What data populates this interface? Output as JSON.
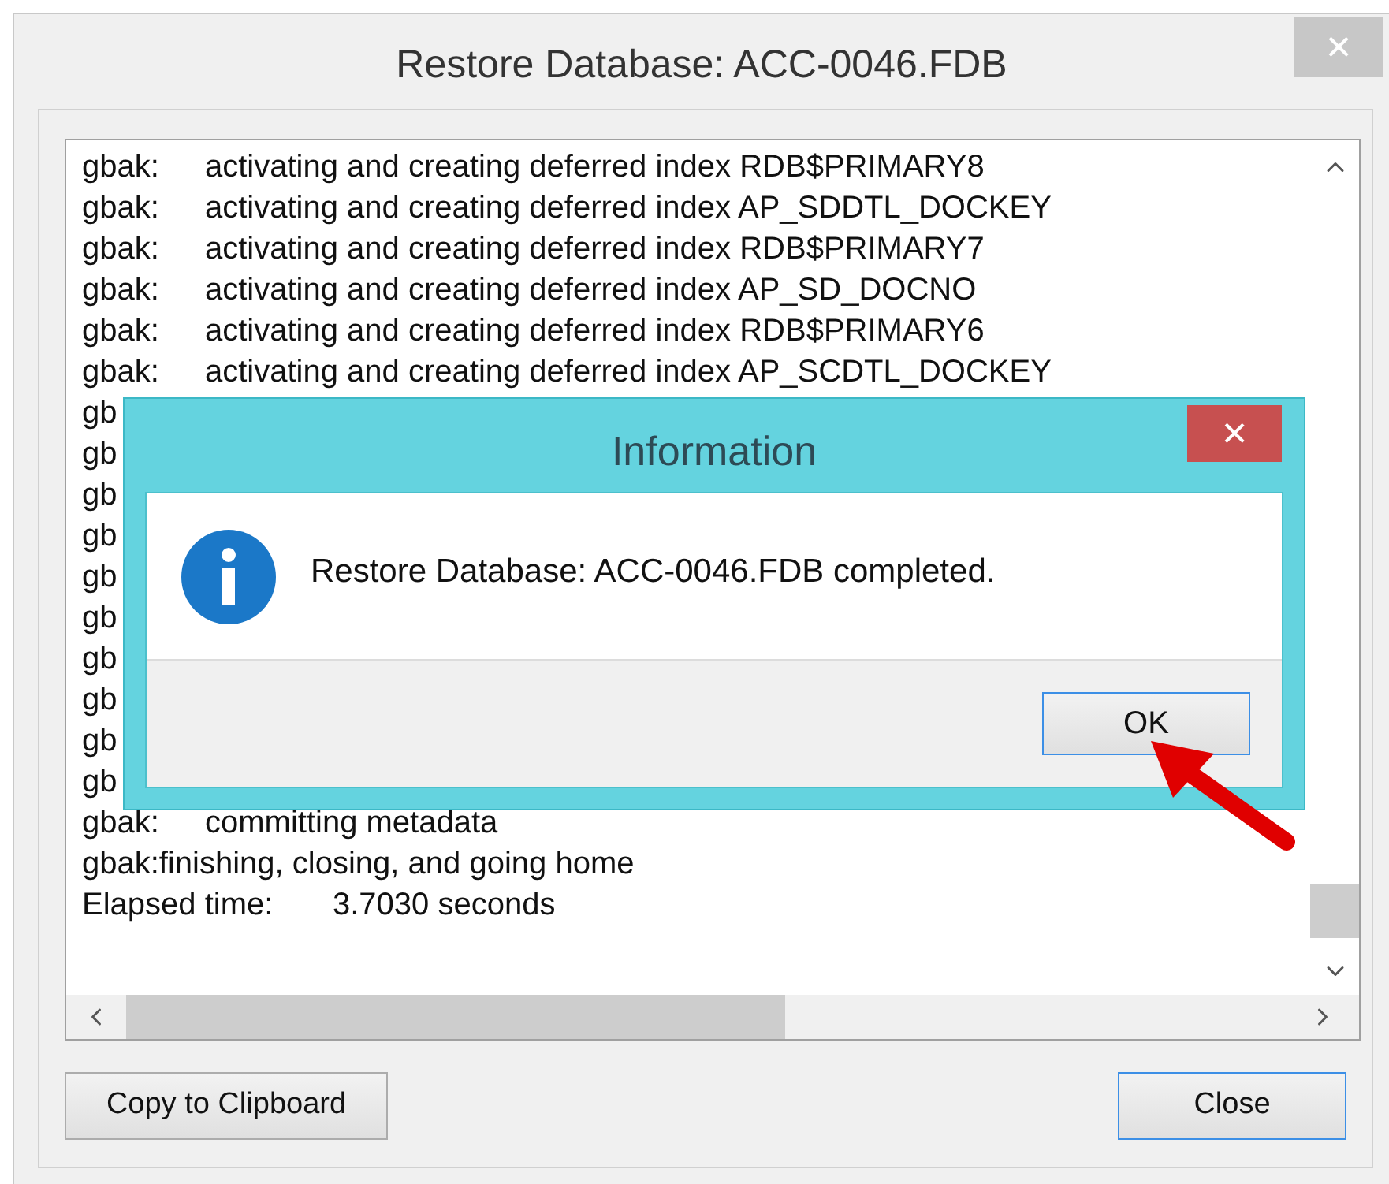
{
  "window": {
    "title": "Restore Database: ACC-0046.FDB",
    "close": "×"
  },
  "log": [
    {
      "kind": "entry",
      "label": "gbak:",
      "text": "activating and creating deferred index RDB$PRIMARY8"
    },
    {
      "kind": "entry",
      "label": "gbak:",
      "text": "activating and creating deferred index AP_SDDTL_DOCKEY"
    },
    {
      "kind": "entry",
      "label": "gbak:",
      "text": "activating and creating deferred index RDB$PRIMARY7"
    },
    {
      "kind": "entry",
      "label": "gbak:",
      "text": "activating and creating deferred index AP_SD_DOCNO"
    },
    {
      "kind": "entry",
      "label": "gbak:",
      "text": "activating and creating deferred index RDB$PRIMARY6"
    },
    {
      "kind": "entry",
      "label": "gbak:",
      "text": "activating and creating deferred index AP_SCDTL_DOCKEY"
    },
    {
      "kind": "cut",
      "text": "gb"
    },
    {
      "kind": "cut",
      "text": "gb"
    },
    {
      "kind": "cut",
      "text": "gb"
    },
    {
      "kind": "cut",
      "text": "gb"
    },
    {
      "kind": "cut",
      "text": "gb"
    },
    {
      "kind": "cut",
      "text": "gb"
    },
    {
      "kind": "cut",
      "text": "gb"
    },
    {
      "kind": "cut",
      "text": "gb"
    },
    {
      "kind": "cut",
      "text": "gb"
    },
    {
      "kind": "cut",
      "text": "gb"
    },
    {
      "kind": "entry",
      "label": "gbak:",
      "text": "committing metadata"
    },
    {
      "kind": "plain",
      "text": "gbak:finishing, closing, and going home"
    },
    {
      "kind": "timing",
      "label": "Elapsed time:",
      "text": "3.7030 seconds"
    }
  ],
  "buttons": [
    {
      "label": "Copy to Clipboard",
      "default": false
    },
    {
      "label": "Close",
      "default": true
    }
  ],
  "dialog": {
    "title": "Information",
    "close": "×",
    "message": "Restore Database: ACC-0046.FDB completed.",
    "button": {
      "label": "OK",
      "default": true
    }
  }
}
